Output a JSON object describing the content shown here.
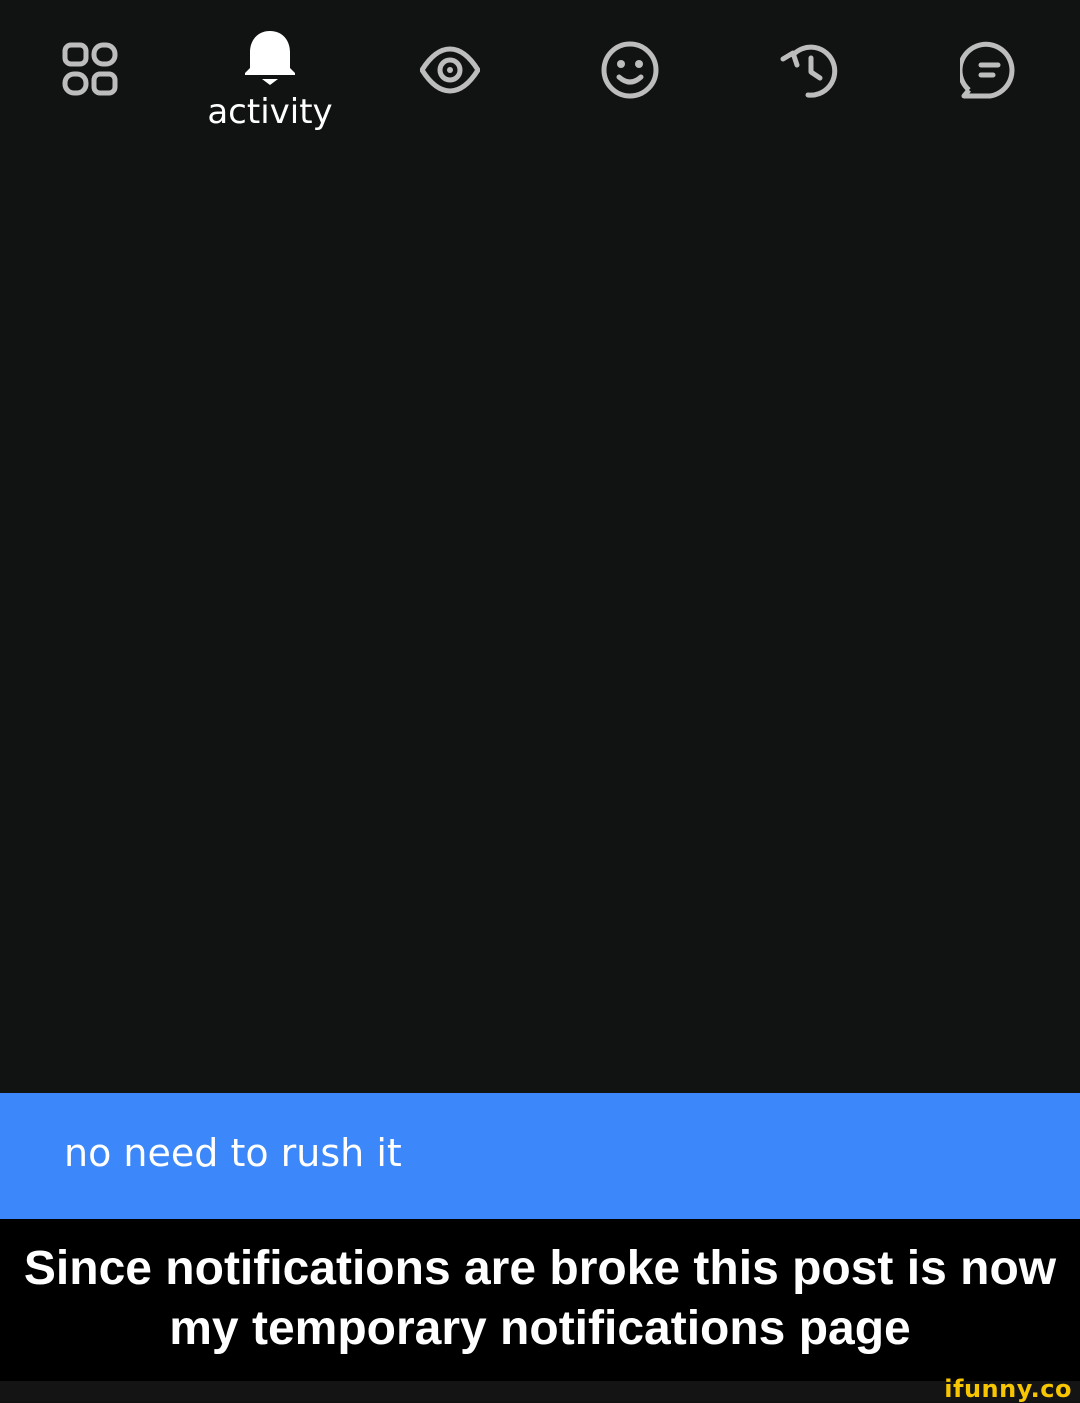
{
  "tab_bar": {
    "tabs": [
      {
        "icon": "widgets-icon",
        "label": ""
      },
      {
        "icon": "bell-icon",
        "label": "activity",
        "selected": true
      },
      {
        "icon": "eye-icon",
        "label": ""
      },
      {
        "icon": "smiley-icon",
        "label": ""
      },
      {
        "icon": "history-icon",
        "label": ""
      },
      {
        "icon": "chat-bubble-icon",
        "label": ""
      }
    ]
  },
  "toast": {
    "text": "no need to rush it"
  },
  "caption": {
    "text": "Since notifications are broke this post is now my temporary notifications page"
  },
  "watermark": {
    "text": "ifunny.co"
  },
  "colors": {
    "background": "#111312",
    "icon": "#bdbdbd",
    "active": "#ffffff",
    "toast": "#3c87f9",
    "caption_bg": "#000000",
    "watermark": "#f7c600"
  }
}
